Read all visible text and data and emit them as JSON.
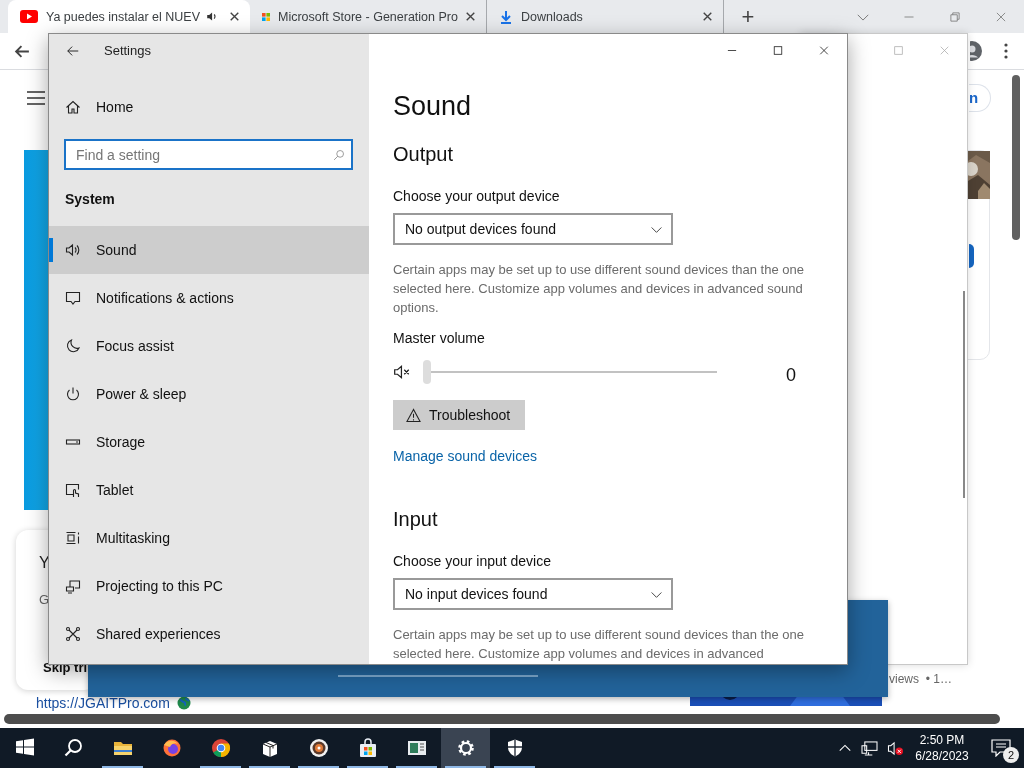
{
  "browser": {
    "tabs": [
      {
        "kind": "youtube",
        "title": "Ya puedes instalar el NUEV",
        "selected": true,
        "audio": true
      },
      {
        "kind": "store",
        "title": "Microsoft Store - Generation Pro",
        "selected": false,
        "audio": false
      },
      {
        "kind": "download",
        "title": "Downloads",
        "selected": false,
        "audio": false
      }
    ],
    "new_tab": "+"
  },
  "page": {
    "left_card": {
      "heading": "Y",
      "subtext": "G",
      "action": "Skip tri"
    },
    "site_link": "https://JGAITPro.com",
    "side_button": "n",
    "video_meta": "views  • 1…"
  },
  "settings": {
    "title": "Settings",
    "home": "Home",
    "search": {
      "placeholder": "Find a setting"
    },
    "section": "System",
    "nav": [
      {
        "label": "Sound",
        "kind": "sound",
        "selected": true
      },
      {
        "label": "Notifications & actions",
        "kind": "notifications",
        "selected": false
      },
      {
        "label": "Focus assist",
        "kind": "focus",
        "selected": false
      },
      {
        "label": "Power & sleep",
        "kind": "power",
        "selected": false
      },
      {
        "label": "Storage",
        "kind": "storage",
        "selected": false
      },
      {
        "label": "Tablet",
        "kind": "tablet",
        "selected": false
      },
      {
        "label": "Multitasking",
        "kind": "multitasking",
        "selected": false
      },
      {
        "label": "Projecting to this PC",
        "kind": "projecting",
        "selected": false
      },
      {
        "label": "Shared experiences",
        "kind": "shared",
        "selected": false
      }
    ],
    "content": {
      "heading": "Sound",
      "sections": [
        {
          "title": "Output",
          "device_label": "Choose your output device",
          "device": "No output devices found",
          "description": "Certain apps may be set up to use different sound devices than the one selected here. Customize app volumes and devices in advanced sound options.",
          "volume": {
            "label": "Master volume",
            "muted": true,
            "level": 0,
            "reading": "0"
          },
          "troubleshoot": "Troubleshoot",
          "link": "Manage sound devices"
        },
        {
          "title": "Input",
          "device_label": "Choose your input device",
          "device": "No input devices found",
          "description": "Certain apps may be set up to use different sound devices than the one selected here. Customize app volumes and devices in advanced"
        }
      ]
    }
  },
  "taskbar": {
    "apps": [
      {
        "kind": "start",
        "running": false,
        "active": false
      },
      {
        "kind": "search",
        "running": false,
        "active": false
      },
      {
        "kind": "explorer",
        "running": true,
        "active": false
      },
      {
        "kind": "firefox",
        "running": false,
        "active": false
      },
      {
        "kind": "chrome",
        "running": true,
        "active": false
      },
      {
        "kind": "package",
        "running": true,
        "active": false
      },
      {
        "kind": "media",
        "running": true,
        "active": false
      },
      {
        "kind": "store",
        "running": true,
        "active": false
      },
      {
        "kind": "news",
        "running": true,
        "active": false
      },
      {
        "kind": "settings",
        "running": true,
        "active": true
      },
      {
        "kind": "shield",
        "running": true,
        "active": false
      }
    ],
    "time": "2:50 PM",
    "date": "6/28/2023",
    "notifications": "2"
  }
}
